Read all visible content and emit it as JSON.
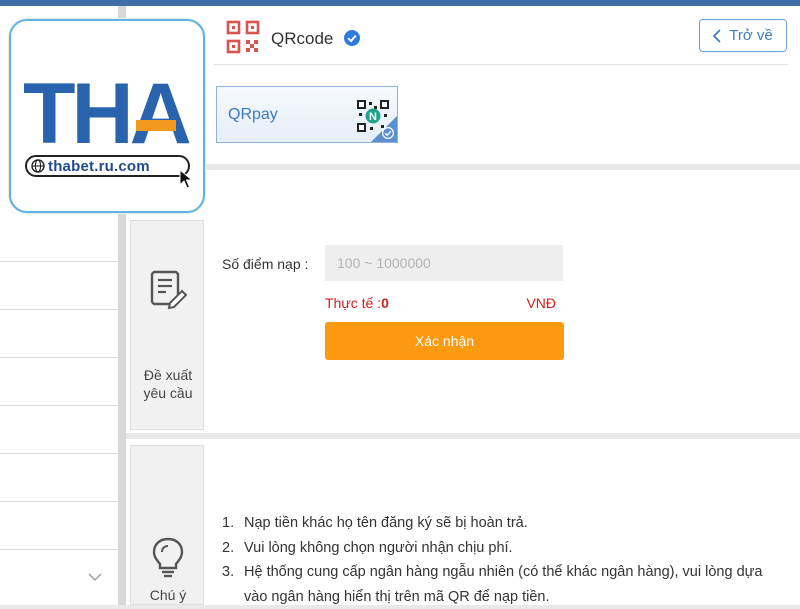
{
  "header": {
    "title": "QRcode",
    "back_label": "Trở về"
  },
  "payment_methods": [
    {
      "label": "QRpay",
      "badge_letter": "N",
      "selected": true
    }
  ],
  "logo": {
    "brand": "THA",
    "url": "thabet.ru.com"
  },
  "sections": {
    "form": {
      "caption_line1": "Đề xuất",
      "caption_line2": "yêu cầu"
    },
    "notes": {
      "caption": "Chú ý"
    }
  },
  "form": {
    "amount_label": "Số điểm nạp :",
    "amount_placeholder": "100 ~ 1000000",
    "actual_label": "Thực tế :",
    "actual_value": "0",
    "currency": "VNĐ",
    "submit_label": "Xác nhận"
  },
  "notes": [
    {
      "num": "1.",
      "text": "Nạp tiền khác họ tên đăng ký sẽ bị hoàn trả."
    },
    {
      "num": "2.",
      "text": "Vui lòng không chọn người nhận chịu phí."
    },
    {
      "num": "3.",
      "text": "Hệ thống cung cấp ngân hàng ngẫu nhiên (có thể khác ngân hàng), vui lòng dựa vào ngân hàng hiển thị trên mã QR để nạp tiền."
    }
  ],
  "colors": {
    "accent": "#fb9a0e",
    "link": "#3f7cc1",
    "warning": "#cc1f1f",
    "logo_blue": "#2a63ad",
    "logo_orange": "#f39a1e"
  }
}
